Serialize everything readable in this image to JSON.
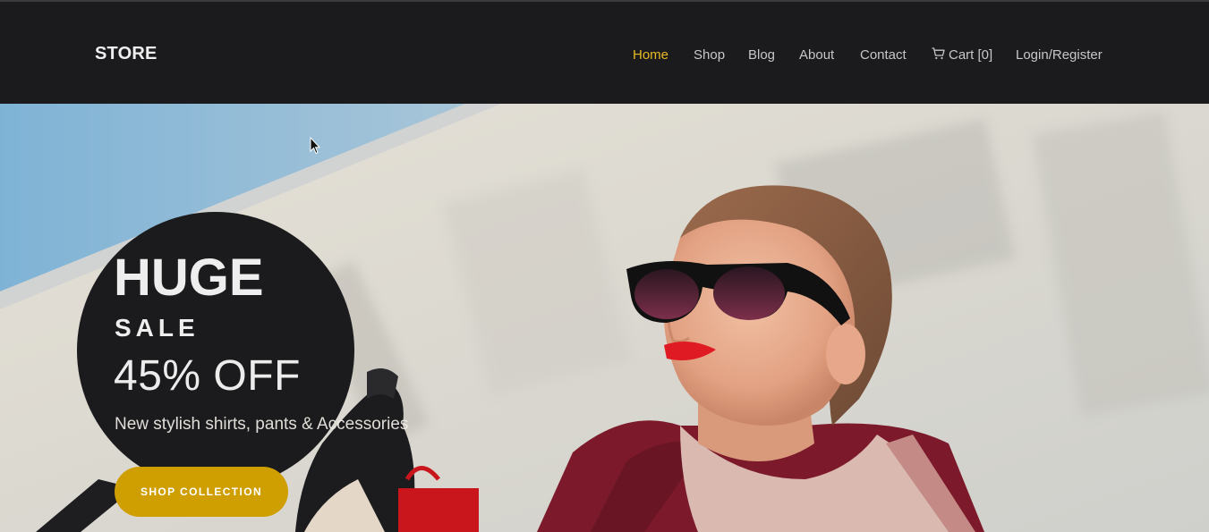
{
  "header": {
    "brand": "STORE",
    "nav": [
      {
        "label": "Home",
        "active": true
      },
      {
        "label": "Shop",
        "active": false
      },
      {
        "label": "Blog",
        "active": false
      },
      {
        "label": "About",
        "active": false
      },
      {
        "label": "Contact",
        "active": false
      },
      {
        "label": "Cart [0]",
        "icon": "cart-icon",
        "active": false
      },
      {
        "label": "Login/Register",
        "active": false
      }
    ]
  },
  "hero": {
    "headline": "HUGE",
    "subheadline": "SALE",
    "offer": "45% OFF",
    "tagline": "New stylish shirts, pants & Accessories",
    "cta_label": "SHOP COLLECTION",
    "image": "woman-in-sunglasses-shopping-photo"
  },
  "colors": {
    "header_bg": "#1b1b1d",
    "nav_text": "#c7c7c9",
    "nav_active": "#e8b923",
    "cta_bg": "#cf9e00"
  }
}
